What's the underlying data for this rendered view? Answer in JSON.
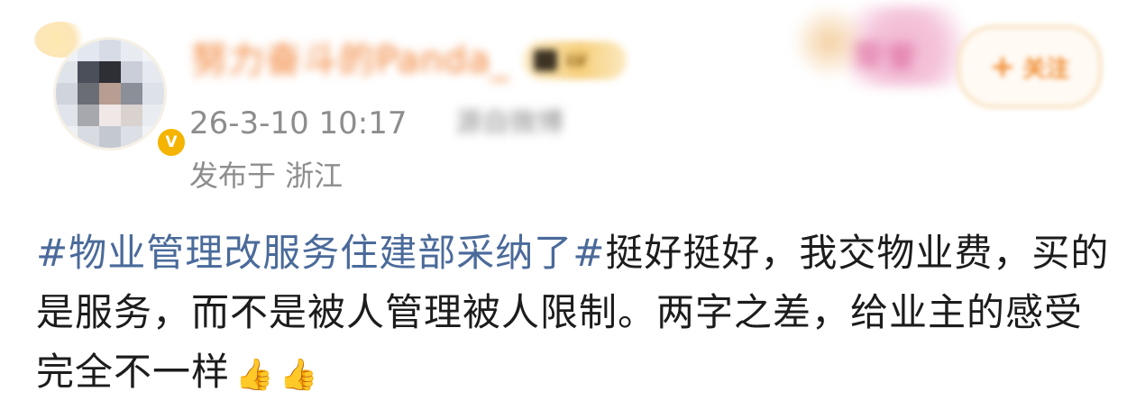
{
  "author": {
    "name": "努力奋斗的Panda_",
    "level_badge": "LV",
    "verified_mark": "V"
  },
  "meta": {
    "time": "26-3-10 10:17",
    "source": "源自微博",
    "location": "发布于 浙江"
  },
  "header_right": {
    "decor_text": "荣誉",
    "follow_label": "关注",
    "follow_plus": "+"
  },
  "post": {
    "hashtag": "#物业管理改服务住建部采纳了#",
    "text": "挺好挺好，我交物业费，买的是服务，而不是被人管理被人限制。两字之差，给业主的感受完全不一样",
    "emoji": [
      "👍",
      "👍"
    ]
  },
  "colors": {
    "hashtag": "#4a6a9a",
    "meta": "#8d8d8d",
    "username": "#f07b2a",
    "follow": "#f08a2c"
  }
}
